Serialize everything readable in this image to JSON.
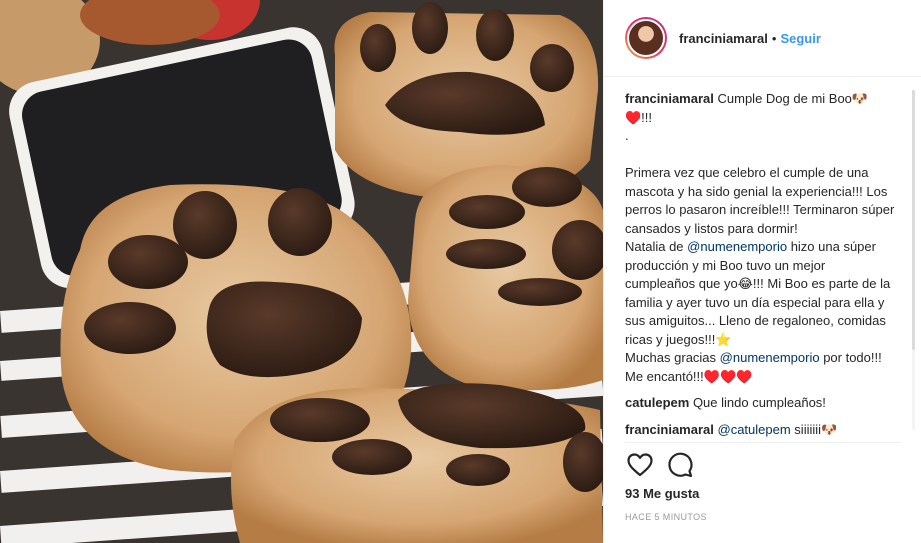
{
  "post": {
    "username": "franciniamaral",
    "follow_label": "Seguir",
    "header_separator": "•",
    "caption_text": "Cumple Dog de mi Boo🐶\n♥️!!!\n.\n\nPrimera vez que celebro el cumple de una mascota y ha sido genial la experiencia!!! Los perros lo pasaron increíble!!! Terminaron súper cansados y listos para dormir!\nNatalia de ",
    "caption_mention_1": "@numenemporio",
    "caption_text_2": " hizo una súper producción y mi Boo tuvo un mejor cumpleaños que yo😂!!! Mi Boo es parte de la familia y ayer tuvo un día especial para ella y sus amiguitos... Lleno de regaloneo, comidas ricas y juegos!!!⭐\nMuchas gracias ",
    "caption_mention_2": "@numenemporio",
    "caption_text_3": " por todo!!! Me encantó!!!♥️♥️♥️",
    "comments": [
      {
        "username": "catulepem",
        "text": "Que lindo cumpleaños!"
      },
      {
        "username": "franciniamaral",
        "mention": "@catulepem",
        "text": " siiiiiii🐶"
      }
    ],
    "likes": "93 Me gusta",
    "timestamp": "HACE 5 MINUTOS",
    "icons": {
      "like": "heart-icon",
      "comment": "comment-icon"
    },
    "colors": {
      "link": "#3897f0",
      "mention": "#003569",
      "muted": "#999999"
    }
  }
}
